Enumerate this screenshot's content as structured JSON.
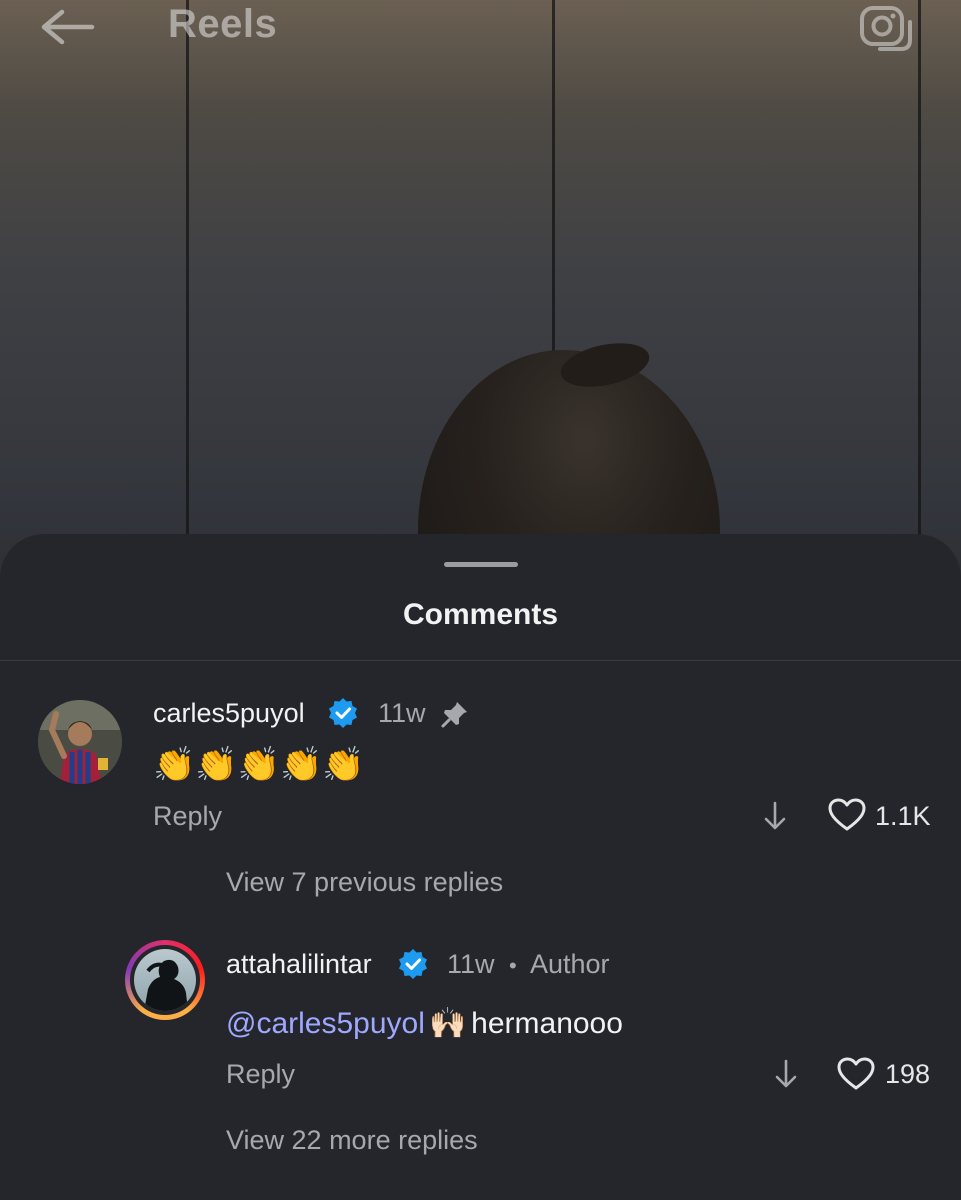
{
  "topbar": {
    "title": "Reels"
  },
  "sheet": {
    "title": "Comments"
  },
  "comments": [
    {
      "username": "carles5puyol",
      "time": "11w",
      "text": "👏👏👏👏👏",
      "reply_label": "Reply",
      "likes": "1.1K"
    }
  ],
  "view_previous": "View 7 previous replies",
  "replies": [
    {
      "username": "attahalilintar",
      "time": "11w",
      "separator": "•",
      "badge": "Author",
      "mention": "@carles5puyol",
      "emoji": "🙌🏻",
      "text": "hermanooo",
      "reply_label": "Reply",
      "likes": "198"
    }
  ],
  "view_more": "View 22 more replies",
  "colors": {
    "verified": "#1d9bf0",
    "mention": "#9ea8ff",
    "sheet_bg": "#24262b"
  }
}
